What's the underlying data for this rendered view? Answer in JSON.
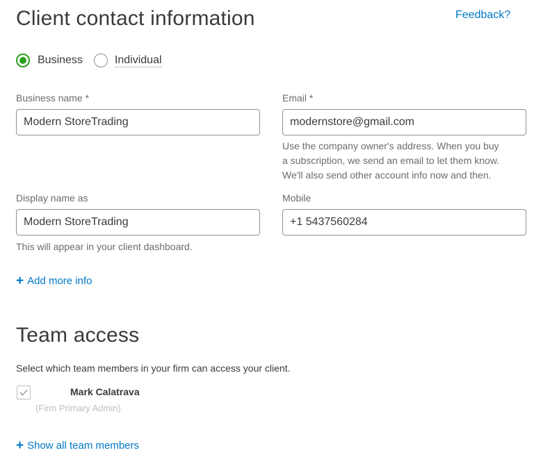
{
  "header": {
    "title": "Client contact information",
    "feedback_link": "Feedback?"
  },
  "client_type": {
    "options": [
      "Business",
      "Individual"
    ],
    "selected": "Business"
  },
  "fields": {
    "business_name": {
      "label": "Business name *",
      "value": "Modern StoreTrading"
    },
    "email": {
      "label": "Email *",
      "value": "modernstore@gmail.com",
      "help_lines": [
        "Use the company owner's address. When you buy",
        "a subscription, we send an email to let them know.",
        "We'll also send other account info now and then."
      ]
    },
    "display_name": {
      "label": "Display name as",
      "value": "Modern StoreTrading",
      "help": "This will appear in your client dashboard."
    },
    "mobile": {
      "label": "Mobile",
      "value": "+1 5437560284"
    }
  },
  "add_more_info": "Add more info",
  "team_access": {
    "title": "Team access",
    "description": "Select which team members in your firm can access your client.",
    "members": [
      {
        "name": "Mark Calatrava",
        "role": "(Firm Primary Admin)",
        "checked": true
      }
    ],
    "show_all_link": "Show all team members"
  },
  "colors": {
    "accent_green": "#2ca01c",
    "link_blue": "#0077c5",
    "text_dark": "#393a3d",
    "text_muted": "#6b6c72"
  }
}
